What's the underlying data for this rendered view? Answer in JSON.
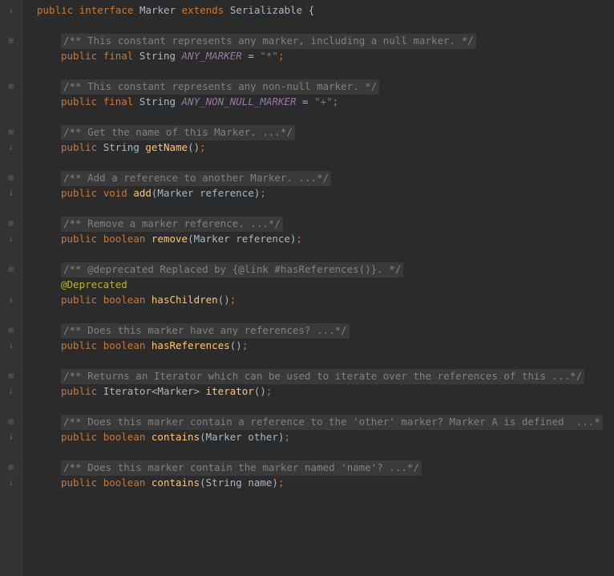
{
  "decl": {
    "public": "public",
    "interface": "interface",
    "name": "Marker",
    "extends": "extends",
    "super": "Serializable",
    "open": "{"
  },
  "blocks": [
    {
      "comment": "/** This constant represents any marker, including a null marker. */",
      "sig": [
        {
          "t": "public ",
          "c": "kw"
        },
        {
          "t": "final ",
          "c": "kw"
        },
        {
          "t": "String ",
          "c": "type"
        },
        {
          "t": "ANY_MARKER",
          "c": "field"
        },
        {
          "t": " = ",
          "c": "type"
        },
        {
          "t": "\"*\"",
          "c": "str"
        },
        {
          "t": ";",
          "c": "semi"
        }
      ],
      "gutter": [
        "fold",
        ""
      ]
    },
    {
      "comment": "/** This constant represents any non-null marker. */",
      "sig": [
        {
          "t": "public ",
          "c": "kw"
        },
        {
          "t": "final ",
          "c": "kw"
        },
        {
          "t": "String ",
          "c": "type"
        },
        {
          "t": "ANY_NON_NULL_MARKER",
          "c": "field"
        },
        {
          "t": " = ",
          "c": "type"
        },
        {
          "t": "\"+\"",
          "c": "str"
        },
        {
          "t": ";",
          "c": "semi"
        }
      ],
      "gutter": [
        "fold",
        ""
      ]
    },
    {
      "comment": "/** Get the name of this Marker. ...*/",
      "sig": [
        {
          "t": "public ",
          "c": "kw"
        },
        {
          "t": "String ",
          "c": "type"
        },
        {
          "t": "getName",
          "c": "method"
        },
        {
          "t": "()",
          "c": "paren"
        },
        {
          "t": ";",
          "c": "semi"
        }
      ],
      "gutter": [
        "fold",
        "impl"
      ]
    },
    {
      "comment": "/** Add a reference to another Marker. ...*/",
      "sig": [
        {
          "t": "public ",
          "c": "kw"
        },
        {
          "t": "void ",
          "c": "kw"
        },
        {
          "t": "add",
          "c": "method"
        },
        {
          "t": "(Marker reference)",
          "c": "paren"
        },
        {
          "t": ";",
          "c": "semi"
        }
      ],
      "gutter": [
        "fold",
        "impl"
      ]
    },
    {
      "comment": "/** Remove a marker reference. ...*/",
      "sig": [
        {
          "t": "public ",
          "c": "kw"
        },
        {
          "t": "boolean ",
          "c": "kw"
        },
        {
          "t": "remove",
          "c": "method"
        },
        {
          "t": "(Marker reference)",
          "c": "paren"
        },
        {
          "t": ";",
          "c": "semi"
        }
      ],
      "gutter": [
        "fold",
        "impl"
      ]
    },
    {
      "comment": "/** @deprecated Replaced by {@link #hasReferences()}. */",
      "anno": "@Deprecated",
      "sig": [
        {
          "t": "public ",
          "c": "kw"
        },
        {
          "t": "boolean ",
          "c": "kw"
        },
        {
          "t": "hasChildren",
          "c": "method"
        },
        {
          "t": "()",
          "c": "paren"
        },
        {
          "t": ";",
          "c": "semi"
        }
      ],
      "gutter": [
        "fold",
        "",
        "impl"
      ]
    },
    {
      "comment": "/** Does this marker have any references? ...*/",
      "sig": [
        {
          "t": "public ",
          "c": "kw"
        },
        {
          "t": "boolean ",
          "c": "kw"
        },
        {
          "t": "hasReferences",
          "c": "method"
        },
        {
          "t": "()",
          "c": "paren"
        },
        {
          "t": ";",
          "c": "semi"
        }
      ],
      "gutter": [
        "fold",
        "impl"
      ]
    },
    {
      "comment": "/** Returns an Iterator which can be used to iterate over the references of this ...*/",
      "sig": [
        {
          "t": "public ",
          "c": "kw"
        },
        {
          "t": "Iterator<Marker> ",
          "c": "type"
        },
        {
          "t": "iterator",
          "c": "method"
        },
        {
          "t": "()",
          "c": "paren"
        },
        {
          "t": ";",
          "c": "semi"
        }
      ],
      "gutter": [
        "fold",
        "impl"
      ]
    },
    {
      "comment": "/** Does this marker contain a reference to the 'other' marker? Marker A is defined  ...*",
      "sig": [
        {
          "t": "public ",
          "c": "kw"
        },
        {
          "t": "boolean ",
          "c": "kw"
        },
        {
          "t": "contains",
          "c": "method"
        },
        {
          "t": "(Marker other)",
          "c": "paren"
        },
        {
          "t": ";",
          "c": "semi"
        }
      ],
      "gutter": [
        "fold",
        "impl"
      ]
    },
    {
      "comment": "/** Does this marker contain the marker named 'name'? ...*/",
      "sig": [
        {
          "t": "public ",
          "c": "kw"
        },
        {
          "t": "boolean ",
          "c": "kw"
        },
        {
          "t": "contains",
          "c": "method"
        },
        {
          "t": "(String name)",
          "c": "paren"
        },
        {
          "t": ";",
          "c": "semi"
        }
      ],
      "gutter": [
        "fold",
        "impl"
      ]
    }
  ],
  "icons": {
    "impl": "↓",
    "fold": "⊞"
  }
}
